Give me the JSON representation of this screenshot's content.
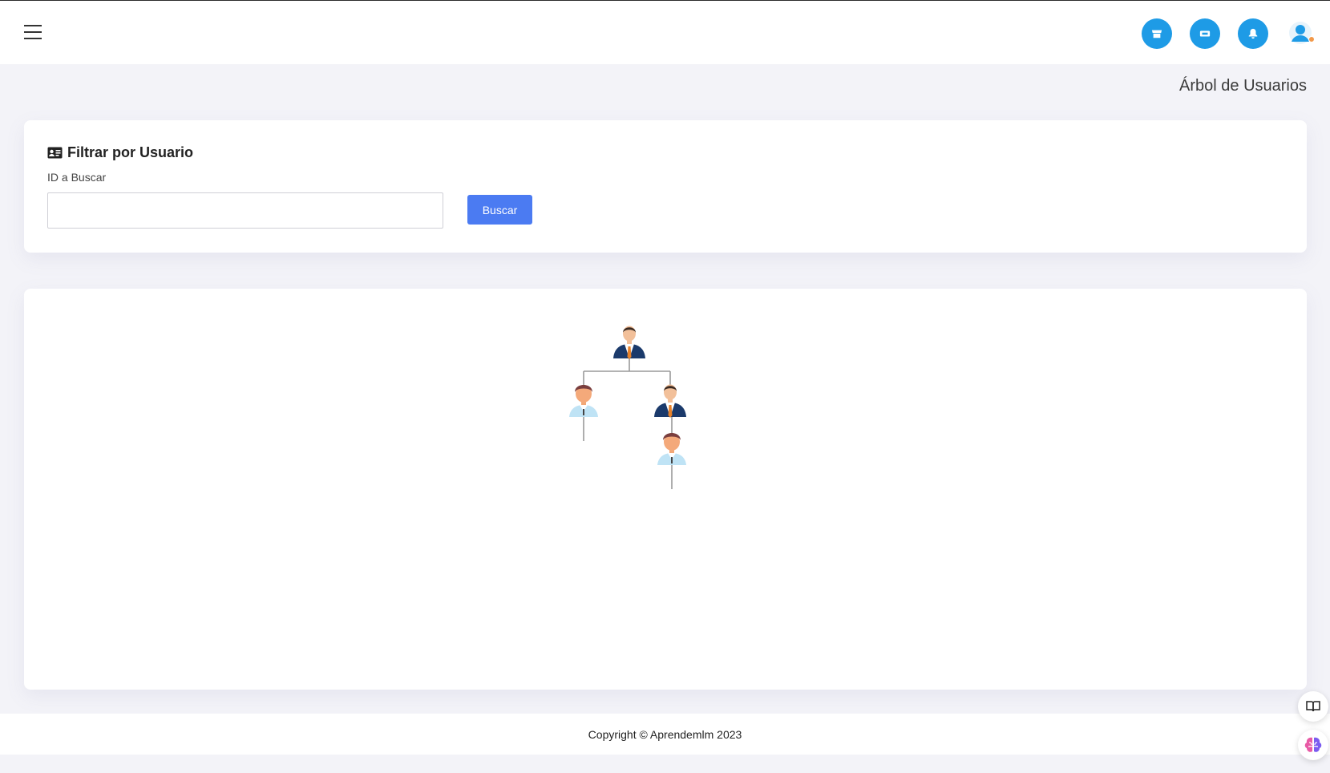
{
  "header": {
    "menu_icon": "hamburger-icon",
    "buttons": [
      {
        "name": "store-icon",
        "color": "#1e9be6"
      },
      {
        "name": "ticket-icon",
        "color": "#1e9be6"
      },
      {
        "name": "bell-icon",
        "color": "#1e9be6"
      }
    ],
    "avatar_icon": "user-avatar-icon"
  },
  "page": {
    "title": "Árbol de Usuarios"
  },
  "filter": {
    "title": "Filtrar por Usuario",
    "title_icon": "id-card-icon",
    "field_label": "ID a Buscar",
    "field_value": "",
    "button_label": "Buscar"
  },
  "tree": {
    "nodes": [
      {
        "id": "root",
        "type": "businessman"
      },
      {
        "id": "child-left",
        "type": "boy"
      },
      {
        "id": "child-right",
        "type": "businessman"
      },
      {
        "id": "grandchild",
        "type": "boy"
      }
    ]
  },
  "footer": {
    "copyright": "Copyright © Aprendemlm 2023"
  },
  "floating": {
    "book_icon": "book-icon",
    "brain_icon": "brain-icon"
  },
  "colors": {
    "accent": "#1e9be6",
    "primary_button": "#4b7bf2",
    "background": "#f3f3f8"
  }
}
